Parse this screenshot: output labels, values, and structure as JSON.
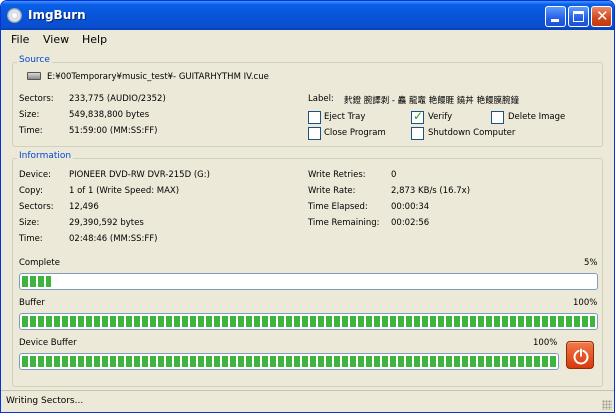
{
  "window": {
    "title": "ImgBurn"
  },
  "menu": {
    "file": "File",
    "view": "View",
    "help": "Help"
  },
  "source": {
    "group_title": "Source",
    "path": "E:¥00Temporary¥music_test¥- GUITARHYTHM IV.cue",
    "sectors_label": "Sectors:",
    "sectors_value": "233,775 (AUDIO/2352)",
    "size_label": "Size:",
    "size_value": "549,838,800 bytes",
    "time_label": "Time:",
    "time_value": "51:59:00 (MM:SS:FF)",
    "label_label": "Label:",
    "label_value": "䴬鐙 腕譯剥 - 麤 龍竈 艳饅睚 鐃丼 艳饅膜腕鐘",
    "options": {
      "eject_tray": {
        "label": "Eject Tray",
        "checked": false
      },
      "verify": {
        "label": "Verify",
        "checked": true
      },
      "delete_image": {
        "label": "Delete Image",
        "checked": false
      },
      "close_program": {
        "label": "Close Program",
        "checked": false
      },
      "shutdown_computer": {
        "label": "Shutdown Computer",
        "checked": false
      }
    }
  },
  "information": {
    "group_title": "Information",
    "device_label": "Device:",
    "device_value": "PIONEER DVD-RW  DVR-215D (G:)",
    "copy_label": "Copy:",
    "copy_value": "1 of 1 (Write Speed: MAX)",
    "sectors_label": "Sectors:",
    "sectors_value": "12,496",
    "size_label": "Size:",
    "size_value": "29,390,592 bytes",
    "time_label": "Time:",
    "time_value": "02:48:46 (MM:SS:FF)",
    "write_retries_label": "Write Retries:",
    "write_retries_value": "0",
    "write_rate_label": "Write Rate:",
    "write_rate_value": "2,873 KB/s (16.7x)",
    "time_elapsed_label": "Time Elapsed:",
    "time_elapsed_value": "00:00:34",
    "time_remaining_label": "Time Remaining:",
    "time_remaining_value": "00:02:56"
  },
  "progress": {
    "complete": {
      "label": "Complete",
      "percent_text": "5%",
      "value": 0.05
    },
    "buffer": {
      "label": "Buffer",
      "percent_text": "100%",
      "value": 1.0
    },
    "device_buffer": {
      "label": "Device Buffer",
      "percent_text": "100%",
      "value": 1.0
    }
  },
  "status": {
    "text": "Writing Sectors..."
  },
  "colors": {
    "accent": "#0046d5",
    "progress_fill": "#3eb43e",
    "titlebar": "#0754d9",
    "power_button": "#d63a0c"
  },
  "icons": {
    "app": "disc-icon",
    "drive": "drive-icon",
    "power": "power-icon"
  }
}
